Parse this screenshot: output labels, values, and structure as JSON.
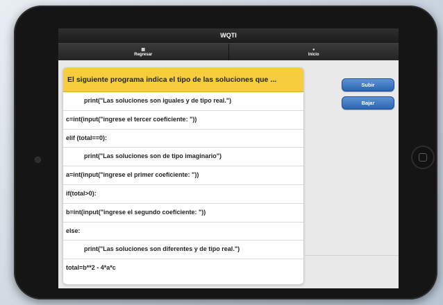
{
  "app": {
    "title": "WQTI"
  },
  "nav": {
    "items": [
      {
        "label": "Regresar",
        "icon": "back-icon"
      },
      {
        "label": "Inicio",
        "icon": "home-icon"
      }
    ]
  },
  "question": {
    "header": "El siguiente programa indica el tipo de las soluciones que ...",
    "lines": [
      {
        "text": "print(\"Las soluciones son iguales y de tipo real.\")",
        "indent": true
      },
      {
        "text": "c=int(input(\"ingrese el tercer coeficiente: \"))",
        "indent": false
      },
      {
        "text": "elif (total==0):",
        "indent": false
      },
      {
        "text": "print(\"Las soluciones son de tipo imaginario\")",
        "indent": true
      },
      {
        "text": "a=int(input(\"ingrese el primer coeficiente: \"))",
        "indent": false
      },
      {
        "text": "if(total>0):",
        "indent": false
      },
      {
        "text": "b=int(input(\"ingrese el segundo coeficiente: \"))",
        "indent": false
      },
      {
        "text": "else:",
        "indent": false
      },
      {
        "text": "print(\"Las soluciones son diferentes y de tipo real.\")",
        "indent": true
      },
      {
        "text": "total=b**2 - 4*a*c",
        "indent": false
      }
    ]
  },
  "controls": {
    "up_label": "Subir",
    "down_label": "Bajar"
  },
  "colors": {
    "header_bg": "#f7cd3e",
    "button_blue": "#2a64b3",
    "bar_dark": "#1c1c1c"
  }
}
